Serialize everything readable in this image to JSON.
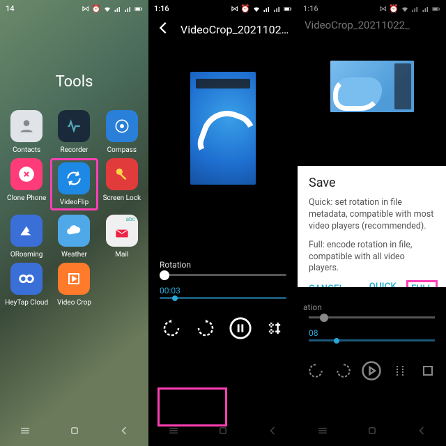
{
  "status": {
    "time1": "14",
    "time2": "1:16",
    "time3": "1:16"
  },
  "pane1": {
    "title": "Tools",
    "apps": [
      {
        "label": "Contacts"
      },
      {
        "label": "Recorder"
      },
      {
        "label": "Compass"
      },
      {
        "label": "Clone Phone"
      },
      {
        "label": "VideoFlip"
      },
      {
        "label": "Screen Lock"
      },
      {
        "label": "ORoaming"
      },
      {
        "label": "Weather"
      },
      {
        "label": "Mail"
      },
      {
        "label": "HeyTap Cloud"
      },
      {
        "label": "Video Crop"
      }
    ]
  },
  "pane2": {
    "filename": "VideoCrop_2021102…",
    "rotation_label": "Rotation",
    "time": "00:03"
  },
  "pane3": {
    "filename": "VideoCrop_20211022_",
    "dialog": {
      "title": "Save",
      "quick_desc": "Quick: set rotation in file metadata, compatible with most video players (recommended).",
      "full_desc": "Full: encode rotation in file, compatible with all video players.",
      "cancel": "CANCEL",
      "quick": "QUICK",
      "full": "FULL"
    },
    "rotation_frag": "ation",
    "time": "08"
  }
}
